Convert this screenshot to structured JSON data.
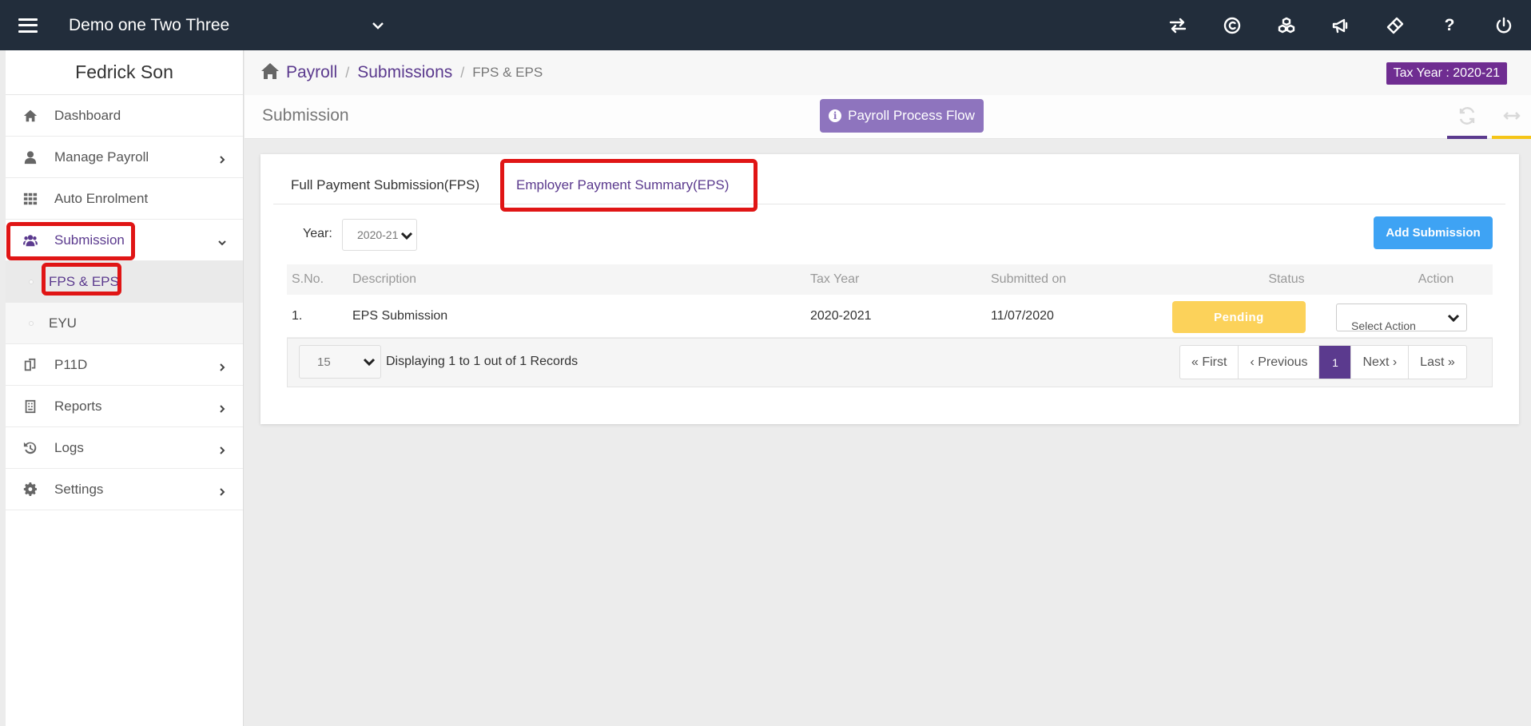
{
  "topbar": {
    "company": "Demo one Two Three",
    "icons": [
      "transfer-icon",
      "c-coin-icon",
      "cubes-icon",
      "megaphone-icon",
      "ticket-icon",
      "help-icon",
      "power-icon"
    ],
    "help_label": "?"
  },
  "sidebar": {
    "user_name": "Fedrick Son",
    "items": [
      {
        "label": "Dashboard",
        "icon": "home-icon"
      },
      {
        "label": "Manage Payroll",
        "icon": "user-icon"
      },
      {
        "label": "Auto Enrolment",
        "icon": "grid-icon"
      },
      {
        "label": "Submission",
        "icon": "users-icon"
      },
      {
        "label": "P11D",
        "icon": "documents-icon"
      },
      {
        "label": "Reports",
        "icon": "report-icon"
      },
      {
        "label": "Logs",
        "icon": "history-icon"
      },
      {
        "label": "Settings",
        "icon": "gear-icon"
      }
    ],
    "submenu": [
      {
        "label": "FPS & EPS"
      },
      {
        "label": "EYU"
      }
    ]
  },
  "breadcrumb": {
    "items": [
      "Payroll",
      "Submissions"
    ],
    "current": "FPS & EPS",
    "tax_year_badge": "Tax Year : 2020-21"
  },
  "titlebar": {
    "title": "Submission",
    "flow_button": "Payroll Process Flow"
  },
  "tabs": {
    "fps": "Full Payment Submission(FPS)",
    "eps": "Employer Payment Summary(EPS)"
  },
  "filters": {
    "year_label": "Year:",
    "year_value": "2020-21",
    "add_button": "Add Submission"
  },
  "table": {
    "headers": [
      "S.No.",
      "Description",
      "Tax Year",
      "Submitted on",
      "Status",
      "Action"
    ],
    "rows": [
      {
        "sno": "1.",
        "description": "EPS Submission",
        "tax_year": "2020-2021",
        "submitted_on": "11/07/2020",
        "status": "Pending",
        "action_placeholder": "Select Action"
      }
    ]
  },
  "pagination": {
    "per_page": "15",
    "records_text": "Displaying 1 to 1 out of 1 Records",
    "first": "First",
    "previous": "Previous",
    "current_page": "1",
    "next": "Next",
    "last": "Last"
  },
  "colors": {
    "topbar": "#222d3b",
    "accent": "#5b3a8e",
    "tax_badge": "#6f2d91",
    "flow_button": "#8e74be",
    "add_button": "#3ea3f4",
    "pending": "#fcd25a",
    "highlight": "#e01515"
  }
}
